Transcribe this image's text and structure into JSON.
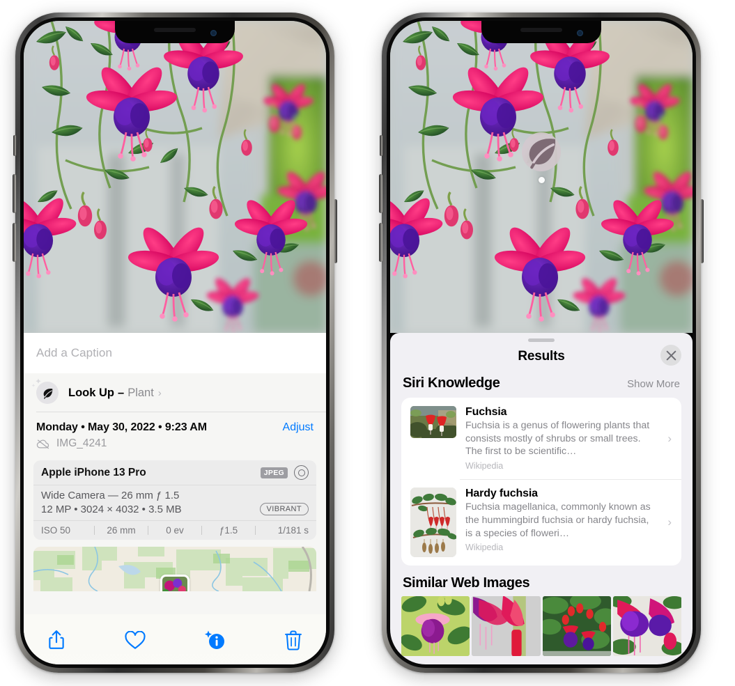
{
  "left_phone": {
    "name": "photos-detail-view",
    "caption": {
      "placeholder": "Add a Caption",
      "value": ""
    },
    "look_up": {
      "label": "Look Up",
      "dash": "–",
      "subject": "Plant",
      "chevron": "›",
      "icon": "leaf-icon"
    },
    "date_row": {
      "date": "Monday • May 30, 2022 • 9:23 AM",
      "adjust_label": "Adjust",
      "filename": "IMG_4241",
      "cloud_icon": "icloud-slash-icon"
    },
    "exif": {
      "model": "Apple iPhone 13 Pro",
      "format_tag": "JPEG",
      "raw_icon": "raw-ring-icon",
      "lens": "Wide Camera — 26 mm ƒ 1.5",
      "size_line": "12 MP • 3024 × 4032 • 3.5 MB",
      "style_tag": "VIBRANT",
      "stats": [
        "ISO 50",
        "26 mm",
        "0 ev",
        "ƒ1.5",
        "1/181 s"
      ]
    },
    "toolbar": [
      {
        "name": "share-button",
        "icon": "share-icon"
      },
      {
        "name": "favorite-button",
        "icon": "heart-icon"
      },
      {
        "name": "info-button",
        "icon": "info-sparkle-icon"
      },
      {
        "name": "delete-button",
        "icon": "trash-icon"
      }
    ]
  },
  "right_phone": {
    "name": "visual-look-up-results",
    "badge": {
      "icon": "leaf-icon",
      "name": "visual-look-up-badge"
    },
    "sheet": {
      "title": "Results",
      "close_icon": "close-icon",
      "siri_knowledge": {
        "title": "Siri Knowledge",
        "show_more": "Show More",
        "items": [
          {
            "title": "Fuchsia",
            "description": "Fuchsia is a genus of flowering plants that consists mostly of shrubs or small trees. The first to be scientific…",
            "source": "Wikipedia",
            "chevron": "›"
          },
          {
            "title": "Hardy fuchsia",
            "description": "Fuchsia magellanica, commonly known as the hummingbird fuchsia or hardy fuchsia, is a species of floweri…",
            "source": "Wikipedia",
            "chevron": "›"
          }
        ]
      },
      "similar_web_images": {
        "title": "Similar Web Images",
        "count": 4
      }
    }
  },
  "colors": {
    "accent_blue": "#007aff",
    "sheet_bg": "#f1f0f4",
    "info_bg": "#f6f6f4",
    "card_bg": "#ececec",
    "secondary_text": "#86868b",
    "page_bg": "#ffffff"
  }
}
